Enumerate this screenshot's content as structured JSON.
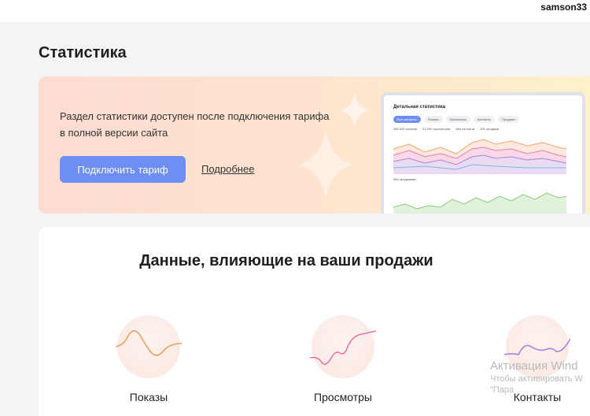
{
  "topbar": {
    "username": "samson33"
  },
  "page": {
    "title": "Статистика"
  },
  "banner": {
    "text": "Раздел статистики доступен после подключения тарифа в полной версии сайта",
    "connect_button": "Подключить тариф",
    "more_link": "Подробнее",
    "preview": {
      "title": "Детальная статистика",
      "tabs": [
        "Все контакты",
        "Показы",
        "Просмотры",
        "Контакты",
        "Продажи"
      ],
      "legend": [
        "285 540 показов",
        "21 000 просмотров",
        "684 контакта",
        "201 продажа"
      ],
      "second_label": "565 продажами"
    }
  },
  "card": {
    "title": "Данные, влияющие на ваши продажи",
    "metrics": [
      {
        "label": "Показы",
        "color": "#f29a5c"
      },
      {
        "label": "Просмотры",
        "color": "#ea6fa8"
      },
      {
        "label": "Контакты",
        "color": "#a57ae0"
      }
    ]
  },
  "watermark": {
    "line1": "Активация Wind",
    "line2": "Чтобы активировать W",
    "line3": "\"Пара"
  },
  "colors": {
    "accent": "#6e8ef5",
    "page_bg": "#f4f4f6"
  }
}
